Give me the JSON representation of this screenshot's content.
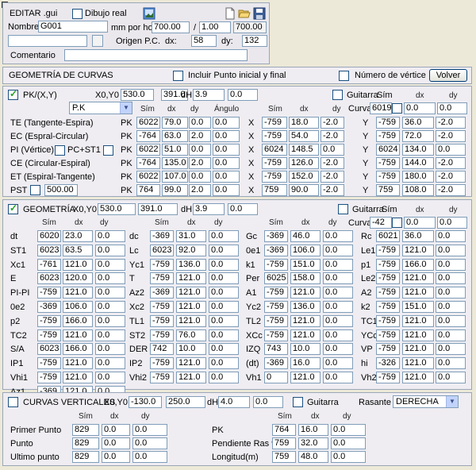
{
  "editor": {
    "title": "EDITAR .gui",
    "dibujo_label": "Dibujo real",
    "nombre_label": "Nombre:",
    "nombre_value": "G001",
    "mm_label": "mm por hoja:",
    "mm_value": "700.00",
    "ratio_label": "/",
    "ratio_value": "1.00",
    "ratio_result": "700.00",
    "origen_label": "Origen P.C.",
    "dx_label": "dx:",
    "dx_value": "58",
    "dy_label": "dy:",
    "dy_value": "132",
    "comentario_label": "Comentario",
    "comentario_value": ""
  },
  "geo_curvas": {
    "title": "GEOMETRÍA DE CURVAS",
    "incluir_label": "Incluir Punto inicial y final",
    "numero_label": "Número de vértice",
    "volver_label": "Volver"
  },
  "pk": {
    "title": "PK/(X,Y)",
    "x0y0_label": "X0,Y0",
    "x0": "530.0",
    "y0": "391.0",
    "dh_label": "dH",
    "dh1": "3.9",
    "dh2": "0.0",
    "guitarra_label": "Guitarra",
    "sim_label": "Sím",
    "dx_label": "dx",
    "dy_label": "dy",
    "angulo_label": "Ángulo",
    "select_value": "P.K",
    "curva_label": "Curva",
    "curva_value": "6019",
    "curva_dx": "0.0",
    "curva_dy": "0.0",
    "pc_st1_label": "PC+ST1",
    "pst_label": "PST",
    "pst_value": "500.00",
    "rows": [
      {
        "label": "TE (Tangente-Espira)",
        "pk": "PK",
        "a": [
          "6022",
          "79.0",
          "0.0",
          "0.0"
        ],
        "x": "X",
        "b": [
          "-759",
          "18.0",
          "-2.0"
        ],
        "y": "Y",
        "c": [
          "-759",
          "36.0",
          "-2.0"
        ]
      },
      {
        "label": "EC (Espral-Circular)",
        "pk": "PK",
        "a": [
          "-764",
          "63.0",
          "2.0",
          "0.0"
        ],
        "x": "X",
        "b": [
          "-759",
          "54.0",
          "-2.0"
        ],
        "y": "Y",
        "c": [
          "-759",
          "72.0",
          "-2.0"
        ]
      },
      {
        "label": "PI (Vértice)",
        "pk": "PK",
        "a": [
          "6022",
          "51.0",
          "0.0",
          "0.0"
        ],
        "x": "X",
        "b": [
          "6024",
          "148.5",
          "0.0"
        ],
        "y": "Y",
        "c": [
          "6024",
          "134.0",
          "0.0"
        ]
      },
      {
        "label": "CE (Circular-Espiral)",
        "pk": "PK",
        "a": [
          "-764",
          "135.0",
          "2.0",
          "0.0"
        ],
        "x": "X",
        "b": [
          "-759",
          "126.0",
          "-2.0"
        ],
        "y": "Y",
        "c": [
          "-759",
          "144.0",
          "-2.0"
        ]
      },
      {
        "label": "ET (Espiral-Tangente)",
        "pk": "PK",
        "a": [
          "6022",
          "107.0",
          "0.0",
          "0.0"
        ],
        "x": "X",
        "b": [
          "-759",
          "152.0",
          "-2.0"
        ],
        "y": "Y",
        "c": [
          "-759",
          "180.0",
          "-2.0"
        ]
      },
      {
        "label": "PST",
        "pk": "PK",
        "a": [
          "764",
          "99.0",
          "2.0",
          "0.0"
        ],
        "x": "X",
        "b": [
          "759",
          "90.0",
          "-2.0"
        ],
        "y": "Y",
        "c": [
          "759",
          "108.0",
          "-2.0"
        ]
      }
    ]
  },
  "geom": {
    "title": "GEOMETRÍA",
    "x0y0_label": "X0,Y0",
    "x0": "530.0",
    "y0": "391.0",
    "dh_label": "dH",
    "dh1": "3.9",
    "dh2": "0.0",
    "guitarra_label": "Guitarra",
    "sim_label": "Sím",
    "dx_label": "dx",
    "dy_label": "dy",
    "curva_label": "Curva",
    "curva_value": "-42",
    "curva_dx": "0.0",
    "curva_dy": "0.0",
    "cols": [
      [
        [
          "dt",
          "6020",
          "23.0",
          "0.0"
        ],
        [
          "ST1",
          "6023",
          "63.5",
          "0.0"
        ],
        [
          "Xc1",
          "-761",
          "121.0",
          "0.0"
        ],
        [
          "E",
          "6023",
          "120.0",
          "0.0"
        ],
        [
          "PI-PI",
          "-759",
          "121.0",
          "0.0"
        ],
        [
          "0e2",
          "-369",
          "106.0",
          "0.0"
        ],
        [
          "p2",
          "-759",
          "166.0",
          "0.0"
        ],
        [
          "TC2",
          "-759",
          "121.0",
          "0.0"
        ],
        [
          "S/A",
          "6023",
          "166.0",
          "0.0"
        ],
        [
          "IP1",
          "-759",
          "121.0",
          "0.0"
        ],
        [
          "Vhi1",
          "-759",
          "121.0",
          "0.0"
        ],
        [
          "Az1",
          "-369",
          "121.0",
          "0.0"
        ]
      ],
      [
        [
          "dc",
          "-369",
          "31.0",
          "0.0"
        ],
        [
          "Lc",
          "6023",
          "92.0",
          "0.0"
        ],
        [
          "Yc1",
          "-759",
          "136.0",
          "0.0"
        ],
        [
          "T",
          "-759",
          "121.0",
          "0.0"
        ],
        [
          "Az2",
          "-369",
          "121.0",
          "0.0"
        ],
        [
          "Xc2",
          "-759",
          "121.0",
          "0.0"
        ],
        [
          "TL1",
          "-759",
          "121.0",
          "0.0"
        ],
        [
          "ST2",
          "-759",
          "76.0",
          "0.0"
        ],
        [
          "DER",
          "742",
          "10.0",
          "0.0"
        ],
        [
          "IP2",
          "-759",
          "121.0",
          "0.0"
        ],
        [
          "Vhi2",
          "-759",
          "121.0",
          "0.0"
        ]
      ],
      [
        [
          "Gc",
          "-369",
          "46.0",
          "0.0"
        ],
        [
          "0e1",
          "-369",
          "106.0",
          "0.0"
        ],
        [
          "k1",
          "-759",
          "151.0",
          "0.0"
        ],
        [
          "Per",
          "6025",
          "158.0",
          "0.0"
        ],
        [
          "A1",
          "-759",
          "121.0",
          "0.0"
        ],
        [
          "Yc2",
          "-759",
          "136.0",
          "0.0"
        ],
        [
          "TL2",
          "-759",
          "121.0",
          "0.0"
        ],
        [
          "XCc",
          "-759",
          "121.0",
          "0.0"
        ],
        [
          "IZQ",
          "743",
          "10.0",
          "0.0"
        ],
        [
          "(dt)",
          "-369",
          "16.0",
          "0.0"
        ],
        [
          "Vh1",
          "0",
          "121.0",
          "0.0"
        ]
      ],
      [
        [
          "Rc",
          "6021",
          "36.0",
          "0.0"
        ],
        [
          "Le1",
          "-759",
          "121.0",
          "0.0"
        ],
        [
          "p1",
          "-759",
          "166.0",
          "0.0"
        ],
        [
          "Le2",
          "-759",
          "121.0",
          "0.0"
        ],
        [
          "A2",
          "-759",
          "121.0",
          "0.0"
        ],
        [
          "k2",
          "-759",
          "151.0",
          "0.0"
        ],
        [
          "TC1",
          "-759",
          "121.0",
          "0.0"
        ],
        [
          "YCc",
          "-759",
          "121.0",
          "0.0"
        ],
        [
          "VP",
          "-759",
          "121.0",
          "0.0"
        ],
        [
          "hi",
          "-326",
          "121.0",
          "0.0"
        ],
        [
          "Vh2",
          "-759",
          "121.0",
          "0.0"
        ]
      ]
    ]
  },
  "verticales": {
    "title": "CURVAS VERTICALES",
    "x0y0_label": "X0,Y0",
    "x0": "-130.0",
    "y0": "250.0",
    "dh_label": "dH",
    "dh1": "4.0",
    "dh2": "0.0",
    "guitarra_label": "Guitarra",
    "rasante_label": "Rasante",
    "rasante_value": "DERECHA",
    "sim_label": "Sím",
    "dx_label": "dx",
    "dy_label": "dy",
    "left": [
      [
        "Primer Punto",
        "829",
        "0.0",
        "0.0"
      ],
      [
        "Punto",
        "829",
        "0.0",
        "0.0"
      ],
      [
        "Ultimo punto",
        "829",
        "0.0",
        "0.0"
      ]
    ],
    "right": [
      [
        "PK",
        "764",
        "16.0",
        "0.0"
      ],
      [
        "Pendiente Ras %",
        "759",
        "32.0",
        "0.0"
      ],
      [
        "Longitud(m)",
        "759",
        "48.0",
        "0.0"
      ]
    ]
  },
  "icons": {
    "image": "image-icon",
    "new": "new-file-icon",
    "open": "open-folder-icon",
    "save": "save-disk-icon",
    "dropdown": "chevron-down-icon"
  }
}
